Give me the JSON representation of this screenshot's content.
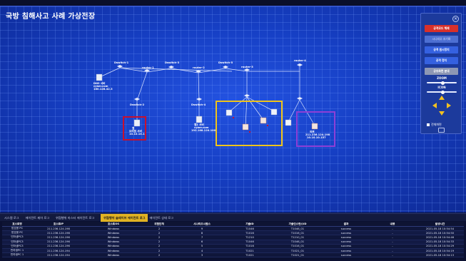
{
  "title": "국방 침해사고 사례 가상전장",
  "colors": {
    "canvas": "#1238b8",
    "highlight_red": "#c8102e",
    "highlight_yellow": "#f0c419",
    "highlight_purple": "#8d3fd6",
    "active_tab": "#e2b322",
    "panel_button_red": "#d8302a"
  },
  "network": {
    "switches": [
      "Dswitch-1",
      "Dswitch-3",
      "Dswitch-5",
      "Dswitch-2",
      "Dswitch-4"
    ],
    "routers": [
      "router-1",
      "router-2",
      "router-3",
      "router-4"
    ],
    "nodes": [
      {
        "name": "DNS 서버",
        "sub": "cyber.com",
        "ip": "160.128.42.3"
      },
      {
        "name": "웹",
        "sub": "모의점 서버",
        "ip": "10.10.10.1"
      },
      {
        "name": "웹1 서버",
        "sub": "cyber.com",
        "ip": "192.168.120.100"
      },
      {
        "name": "외부",
        "sub": "211.236.124.198",
        "ip": "10.10.10.157"
      }
    ]
  },
  "control_panel": {
    "icons": [
      "close-icon",
      "arrow-up-icon",
      "arrow-left-icon",
      "arrow-right-icon",
      "arrow-down-icon",
      "camera-icon"
    ],
    "buttons": [
      {
        "label": "공격모드 해제",
        "style": "red"
      },
      {
        "label": "시나리오 조기화",
        "style": "dim"
      },
      {
        "label": "공격 원시정지",
        "style": "blue"
      },
      {
        "label": "공격 정지",
        "style": "blue"
      },
      {
        "label": "공유화면 분대",
        "style": "gray"
      }
    ],
    "zoom_label": "ZOOM",
    "zoom_value": 0.55,
    "icon_label": "ICON",
    "icon_value": 0.55,
    "checkbox_label": "전체화면"
  },
  "tabs": [
    {
      "label": "시스템 로그",
      "active": false
    },
    {
      "label": "에이전트 제어 로그",
      "active": false
    },
    {
      "label": "위협행위 마스터 에이전트 로그",
      "active": false
    },
    {
      "label": "위협행위 슬레이브 에이전트 로그",
      "active": true
    },
    {
      "label": "에이전트 상태 로그",
      "active": false
    }
  ],
  "table": {
    "headers": [
      "호스트명",
      "호스트IP",
      "호스트OS",
      "위협단계",
      "시나리오시퀀스",
      "기술ID",
      "기술인스턴스ID",
      "결과",
      "내용",
      "발생시간"
    ],
    "rows": [
      [
        "방호용 PC",
        "211.236.124.198",
        "Windows",
        "2",
        "9",
        "T1046",
        "T1046_01",
        "success",
        "-",
        "2021-05-18 10:54:54"
      ],
      [
        "방호용 PC",
        "211.236.124.198",
        "Windows",
        "2",
        "8",
        "T1016",
        "T1016_01",
        "success",
        "-",
        "2021-05-18 10:54:50"
      ],
      [
        "민하생PC3",
        "211.236.124.196",
        "Windows",
        "2",
        "7",
        "T1210",
        "T1210_01",
        "success",
        "-",
        "2021-05-18 10:54:46"
      ],
      [
        "민하생PC3",
        "211.236.124.196",
        "Windows",
        "2",
        "6",
        "T1046",
        "T1046_01",
        "success",
        "-",
        "2021-05-18 10:54:33"
      ],
      [
        "민하생PC3",
        "211.236.124.196",
        "Windows",
        "2",
        "5",
        "T1016",
        "T1016_01",
        "success",
        "-",
        "2021-05-18 10:54:29"
      ],
      [
        "민하생PC 1",
        "211.236.124.194",
        "Windows",
        "2",
        "4",
        "T1021",
        "T1021_01",
        "success",
        "-",
        "2021-05-18 10:54:19"
      ],
      [
        "민하생PC 1",
        "211.236.124.194",
        "Windows",
        "2",
        "3",
        "T1021",
        "T1021_01",
        "success",
        "-",
        "2021-05-18 10:54:13"
      ]
    ]
  }
}
